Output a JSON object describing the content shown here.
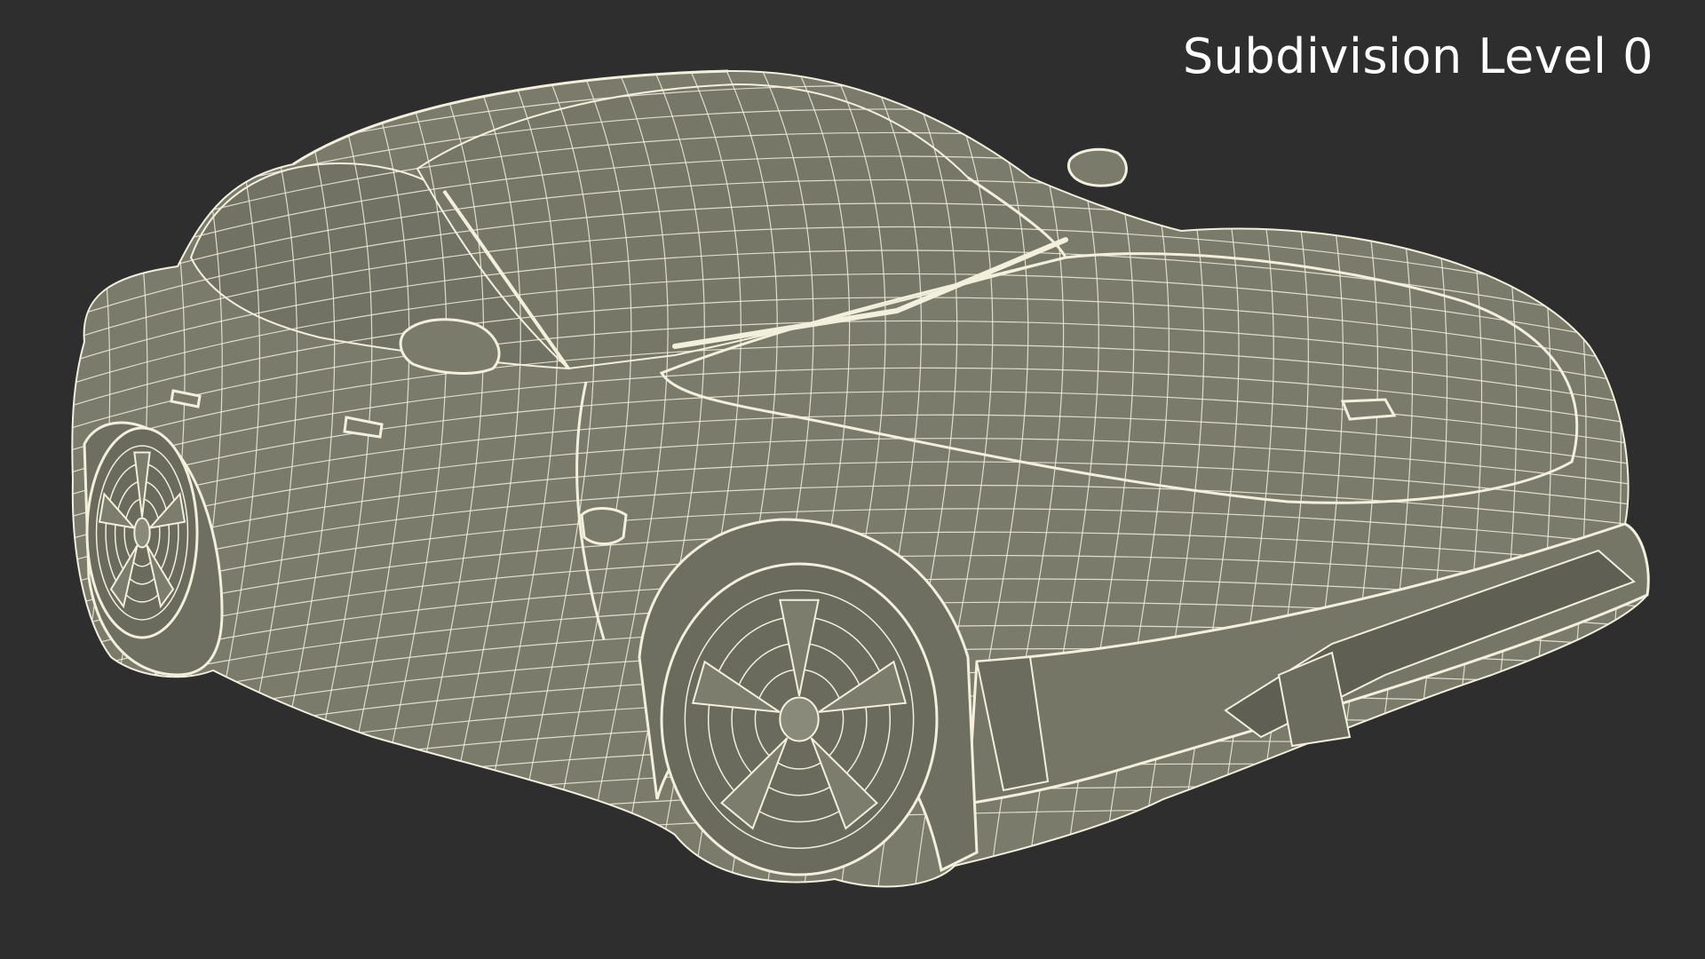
{
  "viewport": {
    "label": "Subdivision Level 0",
    "background_color": "#2e2e2e",
    "model_fill_color": "#7b7b6c",
    "wire_color": "#f2efdc",
    "label_color": "#ffffff"
  }
}
